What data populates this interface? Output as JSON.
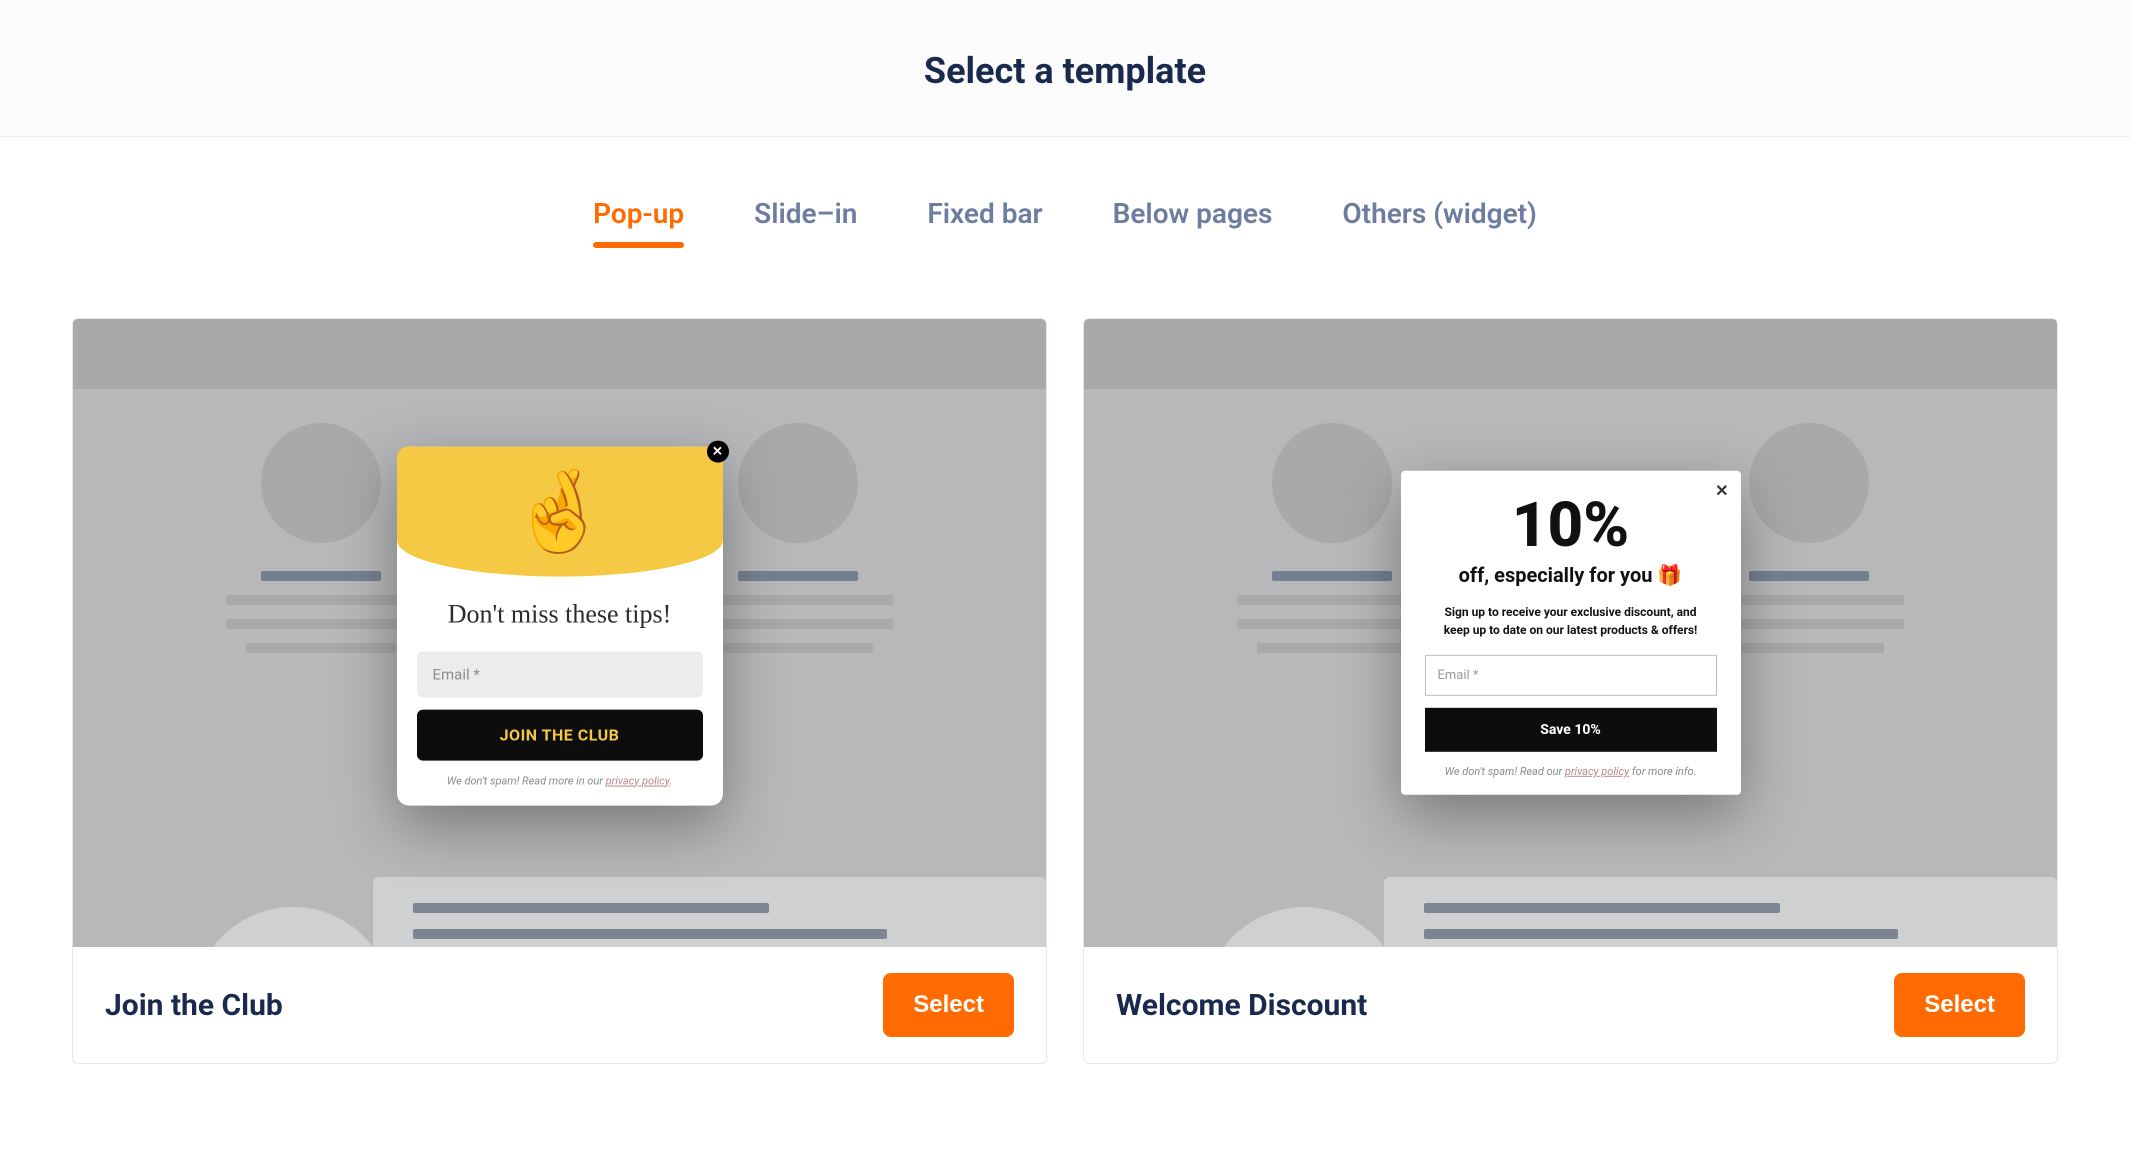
{
  "header": {
    "title": "Select a template"
  },
  "tabs": [
    {
      "label": "Pop-up",
      "active": true
    },
    {
      "label": "Slide–in",
      "active": false
    },
    {
      "label": "Fixed bar",
      "active": false
    },
    {
      "label": "Below pages",
      "active": false
    },
    {
      "label": "Others (widget)",
      "active": false
    }
  ],
  "templates": [
    {
      "name": "Join the Club",
      "select_label": "Select",
      "popup": {
        "heading": "Don't miss these tips!",
        "email_placeholder": "Email *",
        "cta": "JOIN THE CLUB",
        "fine_print_prefix": "We don't spam! Read more in our ",
        "fine_print_link": "privacy policy",
        "fine_print_suffix": ".",
        "emoji_name": "fingers-crossed-icon",
        "emoji": "🤞"
      }
    },
    {
      "name": "Welcome Discount",
      "select_label": "Select",
      "popup": {
        "big": "10%",
        "subtitle": "off, especially for you 🎁",
        "description": "Sign up to receive your exclusive discount, and keep up to date on our latest products & offers!",
        "email_placeholder": "Email *",
        "cta": "Save 10%",
        "fine_print_prefix": "We don't spam! Read our ",
        "fine_print_link": "privacy policy",
        "fine_print_suffix": " for more info."
      }
    }
  ]
}
